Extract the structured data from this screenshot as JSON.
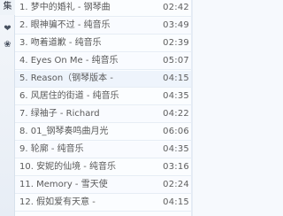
{
  "sidebar": {
    "label": "集",
    "icons": [
      {
        "name": "heart-icon",
        "glyph": "❤"
      },
      {
        "name": "flower-icon",
        "glyph": "❀"
      }
    ]
  },
  "playlist": {
    "rows": [
      {
        "title": "1. 梦中的婚礼 - 钢琴曲",
        "time": "02:42"
      },
      {
        "title": "2. 眼神骗不过 - 纯音乐",
        "time": "03:49"
      },
      {
        "title": "3. 吻着道歉 - 纯音乐",
        "time": "02:39"
      },
      {
        "title": "4. Eyes On Me - 纯音乐",
        "time": "05:07"
      },
      {
        "title": "5. Reason（钢琴版本 -",
        "time": "04:15"
      },
      {
        "title": "6. 风居住的街道 - 纯音乐",
        "time": "04:35"
      },
      {
        "title": "7. 绿袖子 - Richard",
        "time": "04:22"
      },
      {
        "title": "8. 01_钢琴奏鸣曲月光",
        "time": "06:06"
      },
      {
        "title": "9. 轮廓 - 纯音乐",
        "time": "04:35"
      },
      {
        "title": "10. 安妮的仙境 - 纯音乐",
        "time": "03:16"
      },
      {
        "title": "11. Memory - 雪天使",
        "time": "02:24"
      },
      {
        "title": "12. 假如爱有天意 -",
        "time": "04:15"
      }
    ]
  }
}
